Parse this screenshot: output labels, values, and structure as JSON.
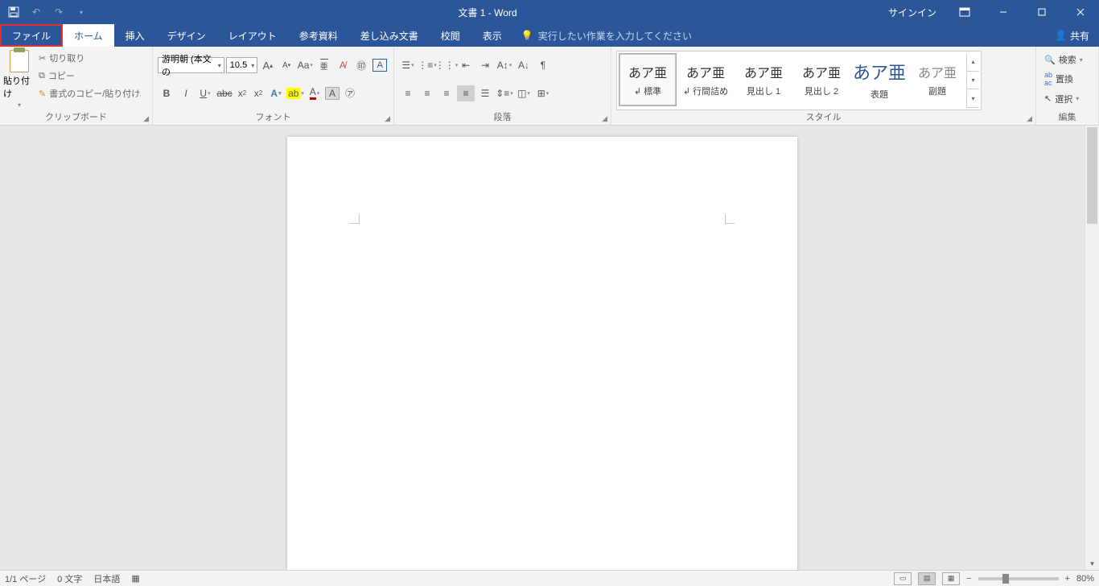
{
  "title": "文書 1 - Word",
  "signin": "サインイン",
  "share": "共有",
  "tabs": {
    "file": "ファイル",
    "home": "ホーム",
    "insert": "挿入",
    "design": "デザイン",
    "layout": "レイアウト",
    "references": "参考資料",
    "mailings": "差し込み文書",
    "review": "校閲",
    "view": "表示"
  },
  "tellme": "実行したい作業を入力してください",
  "clipboard": {
    "paste": "貼り付け",
    "cut": "切り取り",
    "copy": "コピー",
    "formatpainter": "書式のコピー/貼り付け",
    "label": "クリップボード"
  },
  "font": {
    "name": "游明朝 (本文の",
    "size": "10.5",
    "label": "フォント"
  },
  "para": {
    "label": "段落"
  },
  "styles": {
    "label": "スタイル",
    "items": [
      {
        "preview": "あア亜",
        "name": "↲ 標準"
      },
      {
        "preview": "あア亜",
        "name": "↲ 行間詰め"
      },
      {
        "preview": "あア亜",
        "name": "見出し 1"
      },
      {
        "preview": "あア亜",
        "name": "見出し 2"
      },
      {
        "preview": "あア亜",
        "name": "表題"
      },
      {
        "preview": "あア亜",
        "name": "副題"
      }
    ]
  },
  "editing": {
    "find": "検索",
    "replace": "置換",
    "select": "選択",
    "label": "編集"
  },
  "status": {
    "page": "1/1 ページ",
    "words": "0 文字",
    "lang": "日本語",
    "zoom": "80%"
  }
}
